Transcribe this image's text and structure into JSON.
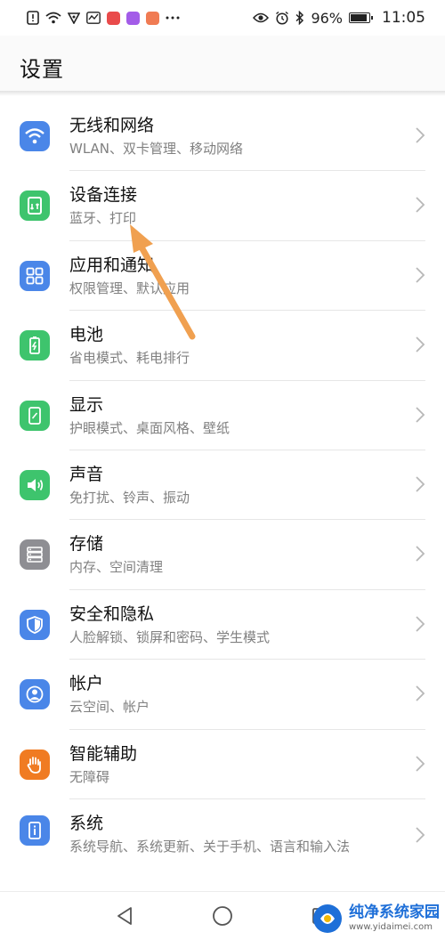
{
  "status_bar": {
    "battery_percent": "96%",
    "battery_level": 0.96,
    "time": "11:05",
    "left_icons": [
      "alert-icon",
      "wifi-icon",
      "vpn-icon",
      "activity-icon",
      "app-icon-red",
      "app-icon-purple",
      "app-icon-orange",
      "more-icon"
    ],
    "right_icons": [
      "eye-icon",
      "alarm-icon",
      "bluetooth-icon",
      "battery-icon"
    ]
  },
  "header": {
    "title": "设置"
  },
  "items": [
    {
      "title": "无线和网络",
      "subtitle": "WLAN、双卡管理、移动网络",
      "icon": "wifi-icon",
      "color": "#4a86e8"
    },
    {
      "title": "设备连接",
      "subtitle": "蓝牙、打印",
      "icon": "device-connect-icon",
      "color": "#3ec46d"
    },
    {
      "title": "应用和通知",
      "subtitle": "权限管理、默认应用",
      "icon": "apps-grid-icon",
      "color": "#4a86e8"
    },
    {
      "title": "电池",
      "subtitle": "省电模式、耗电排行",
      "icon": "battery-icon",
      "color": "#3ec46d"
    },
    {
      "title": "显示",
      "subtitle": "护眼模式、桌面风格、壁纸",
      "icon": "display-icon",
      "color": "#3ec46d"
    },
    {
      "title": "声音",
      "subtitle": "免打扰、铃声、振动",
      "icon": "speaker-icon",
      "color": "#3ec46d"
    },
    {
      "title": "存储",
      "subtitle": "内存、空间清理",
      "icon": "storage-icon",
      "color": "#8e8e93"
    },
    {
      "title": "安全和隐私",
      "subtitle": "人脸解锁、锁屏和密码、学生模式",
      "icon": "shield-icon",
      "color": "#4a86e8"
    },
    {
      "title": "帐户",
      "subtitle": "云空间、帐户",
      "icon": "account-icon",
      "color": "#4a86e8"
    },
    {
      "title": "智能辅助",
      "subtitle": "无障碍",
      "icon": "hand-icon",
      "color": "#f07b22"
    },
    {
      "title": "系统",
      "subtitle": "系统导航、系统更新、关于手机、语言和输入法",
      "icon": "info-icon",
      "color": "#4a86e8"
    }
  ],
  "annotation": {
    "icon": "annotation-arrow-icon",
    "color": "#f0a050"
  },
  "navbar": {
    "icons": [
      "back-icon",
      "home-icon",
      "recents-icon"
    ]
  },
  "watermark": {
    "brand": "纯净系统家园",
    "url": "www.yidaimei.com"
  }
}
